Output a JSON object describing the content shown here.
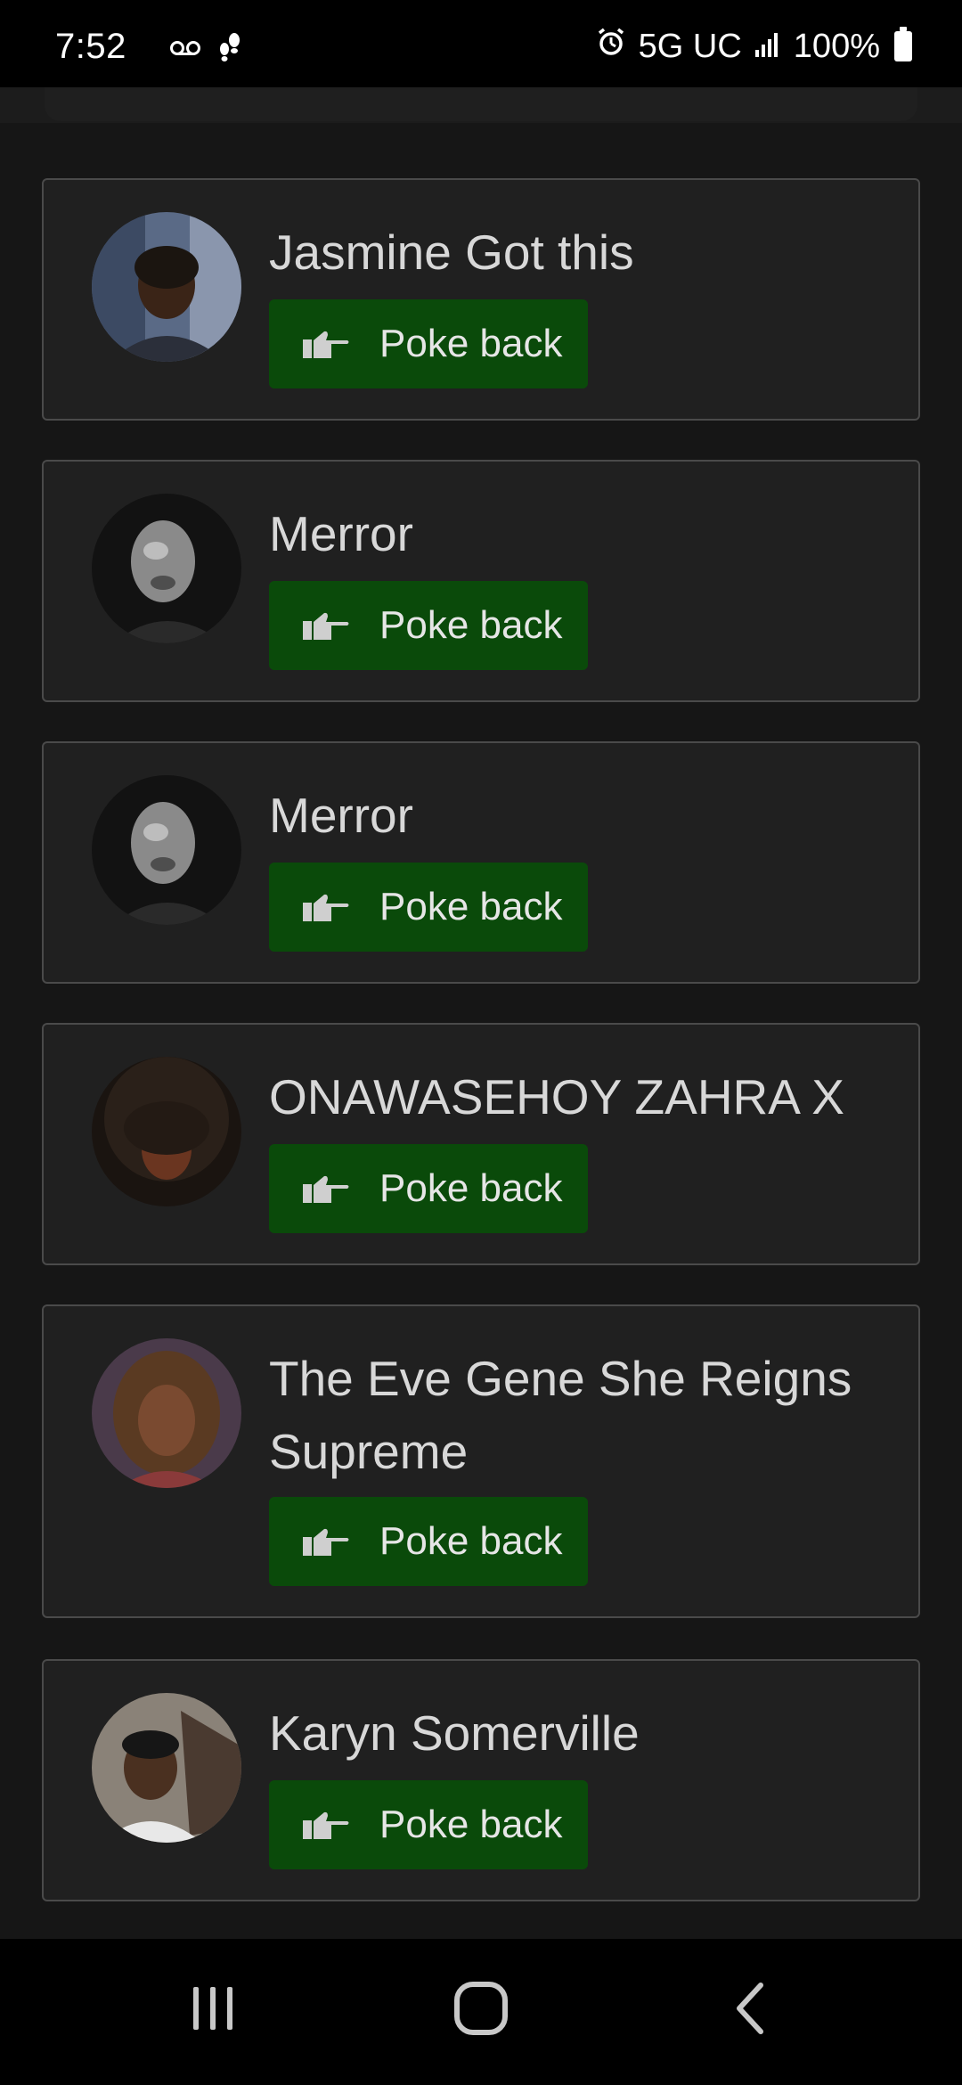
{
  "status_bar": {
    "time": "7:52",
    "network": "5G UC",
    "battery": "100%",
    "icons": [
      "voicemail-icon",
      "footsteps-icon",
      "alarm-icon",
      "signal-icon",
      "battery-icon"
    ]
  },
  "pokes": [
    {
      "name": "Jasmine Got this",
      "button_label": "Poke back",
      "avatar": "avatar-photo"
    },
    {
      "name": "Merror",
      "button_label": "Poke back",
      "avatar": "avatar-photo"
    },
    {
      "name": "Merror",
      "button_label": "Poke back",
      "avatar": "avatar-photo"
    },
    {
      "name": "ONAWASEHOY ZAHRA X",
      "button_label": "Poke back",
      "avatar": "avatar-photo"
    },
    {
      "name": "The Eve Gene She Reigns Supreme",
      "button_label": "Poke back",
      "avatar": "avatar-photo"
    },
    {
      "name": "Karyn Somerville",
      "button_label": "Poke back",
      "avatar": "avatar-photo"
    }
  ],
  "nav_bar": {
    "buttons": [
      "recent-apps",
      "home",
      "back"
    ]
  },
  "colors": {
    "background": "#161616",
    "card": "#202020",
    "card_border": "#4a4a4a",
    "button": "#0a4a0a",
    "text": "#d8d8d8"
  }
}
